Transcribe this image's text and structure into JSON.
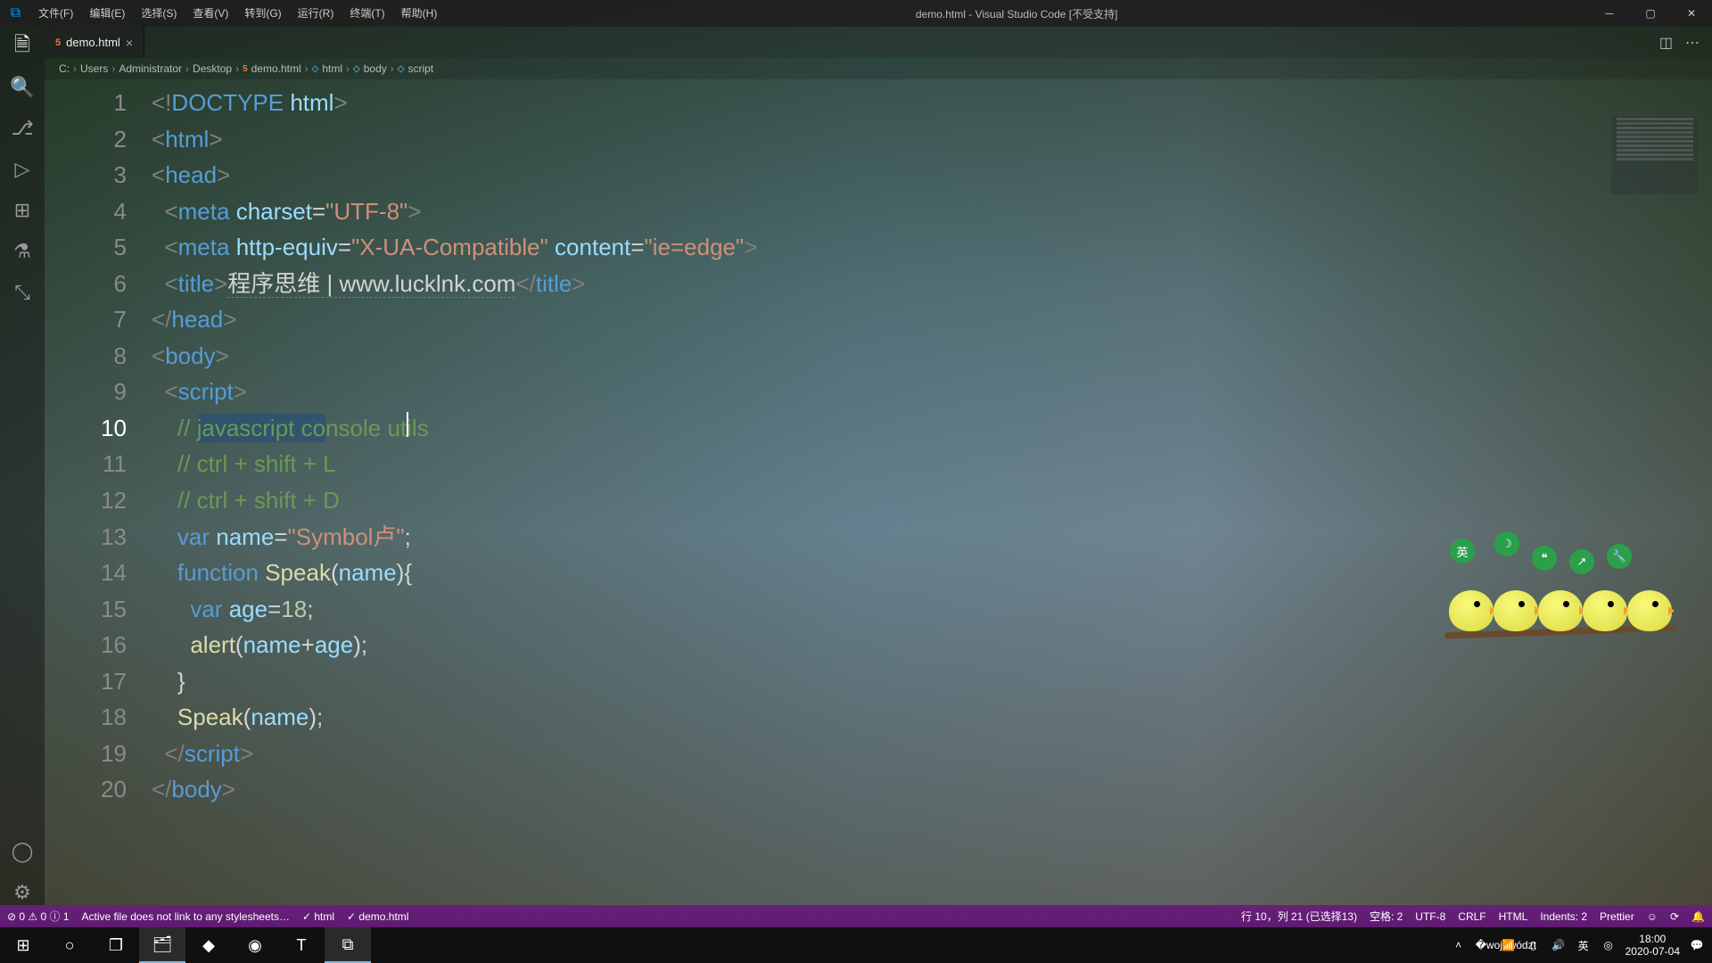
{
  "titlebar": {
    "menus": [
      "文件(F)",
      "编辑(E)",
      "选择(S)",
      "查看(V)",
      "转到(G)",
      "运行(R)",
      "终端(T)",
      "帮助(H)"
    ],
    "title": "demo.html - Visual Studio Code [不受支持]"
  },
  "tab": {
    "filename": "demo.html"
  },
  "breadcrumbs": {
    "parts": [
      "C:",
      "Users",
      "Administrator",
      "Desktop"
    ],
    "file": "demo.html",
    "symbols": [
      "html",
      "body",
      "script"
    ]
  },
  "code": {
    "lines": [
      {
        "n": 1,
        "html": "<span class='tok-punc'>&lt;!</span><span class='tok-doctype'>DOCTYPE</span> <span class='tok-attr'>html</span><span class='tok-punc'>&gt;</span>"
      },
      {
        "n": 2,
        "html": "<span class='tok-punc'>&lt;</span><span class='tok-tag'>html</span><span class='tok-punc'>&gt;</span>"
      },
      {
        "n": 3,
        "html": "<span class='tok-punc'>&lt;</span><span class='tok-tag'>head</span><span class='tok-punc'>&gt;</span>"
      },
      {
        "n": 4,
        "html": "  <span class='tok-punc'>&lt;</span><span class='tok-tag'>meta</span> <span class='tok-attr'>charset</span><span class='tok-op'>=</span><span class='tok-str'>\"UTF-8\"</span><span class='tok-punc'>&gt;</span>"
      },
      {
        "n": 5,
        "html": "  <span class='tok-punc'>&lt;</span><span class='tok-tag'>meta</span> <span class='tok-attr'>http-equiv</span><span class='tok-op'>=</span><span class='tok-str'>\"X-UA-Compatible\"</span> <span class='tok-attr'>content</span><span class='tok-op'>=</span><span class='tok-str'>\"ie=edge\"</span><span class='tok-punc'>&gt;</span>"
      },
      {
        "n": 6,
        "html": "  <span class='tok-punc'>&lt;</span><span class='tok-tag'>title</span><span class='tok-punc'>&gt;</span><span class='tok-title'>程序思维 | www.lucklnk.com</span><span class='tok-punc'>&lt;/</span><span class='tok-tag'>title</span><span class='tok-punc'>&gt;</span>"
      },
      {
        "n": 7,
        "html": "<span class='tok-punc'>&lt;/</span><span class='tok-tag'>head</span><span class='tok-punc'>&gt;</span>"
      },
      {
        "n": 8,
        "html": "<span class='tok-punc'>&lt;</span><span class='tok-tag'>body</span><span class='tok-punc'>&gt;</span>"
      },
      {
        "n": 9,
        "html": "  <span class='tok-punc'>&lt;</span><span class='tok-tag'>script</span><span class='tok-punc'>&gt;</span>"
      },
      {
        "n": 10,
        "current": true,
        "html": "    <span class='tok-com'>// <span class='selection'>javascript co</span>nsole utils</span>",
        "cursor": 286
      },
      {
        "n": 11,
        "html": "    <span class='tok-com'>// ctrl + shift + L</span>"
      },
      {
        "n": 12,
        "html": "    <span class='tok-com'>// ctrl + shift + D</span>"
      },
      {
        "n": 13,
        "html": "    <span class='tok-kw'>var</span> <span class='tok-var'>name</span><span class='tok-op'>=</span><span class='tok-str'>\"Symbol卢\"</span><span class='tok-text'>;</span>"
      },
      {
        "n": 14,
        "html": "    <span class='tok-kw'>function</span> <span class='tok-fn'>Speak</span><span class='tok-text'>(</span><span class='tok-var'>name</span><span class='tok-text'>){</span>"
      },
      {
        "n": 15,
        "html": "      <span class='tok-kw'>var</span> <span class='tok-var'>age</span><span class='tok-op'>=</span><span class='tok-num'>18</span><span class='tok-text'>;</span>"
      },
      {
        "n": 16,
        "html": "      <span class='tok-fn'>alert</span><span class='tok-text'>(</span><span class='tok-var'>name</span><span class='tok-op'>+</span><span class='tok-var'>age</span><span class='tok-text'>);</span>"
      },
      {
        "n": 17,
        "html": "    <span class='tok-text'>}</span>"
      },
      {
        "n": 18,
        "html": "    <span class='tok-fn'>Speak</span><span class='tok-text'>(</span><span class='tok-var'>name</span><span class='tok-text'>);</span>"
      },
      {
        "n": 19,
        "html": "  <span class='tok-punc'>&lt;/</span><span class='tok-tag'>script</span><span class='tok-punc'>&gt;</span>"
      },
      {
        "n": 20,
        "html": "<span class='tok-punc'>&lt;/</span><span class='tok-tag'>body</span><span class='tok-punc'>&gt;</span>"
      }
    ]
  },
  "statusbar": {
    "errors": "⊘ 0 ⚠ 0 ⓘ 1",
    "hint": "Active file does not link to any stylesheets…",
    "check1": "✓ html",
    "check2": "✓ demo.html",
    "position": "行 10，列 21 (已选择13)",
    "spaces": "空格: 2",
    "encoding": "UTF-8",
    "eol": "CRLF",
    "lang": "HTML",
    "indents": "Indents: 2",
    "prettier": "Prettier"
  },
  "tray": {
    "ime": "英",
    "time": "18:00",
    "date": "2020-07-04"
  }
}
